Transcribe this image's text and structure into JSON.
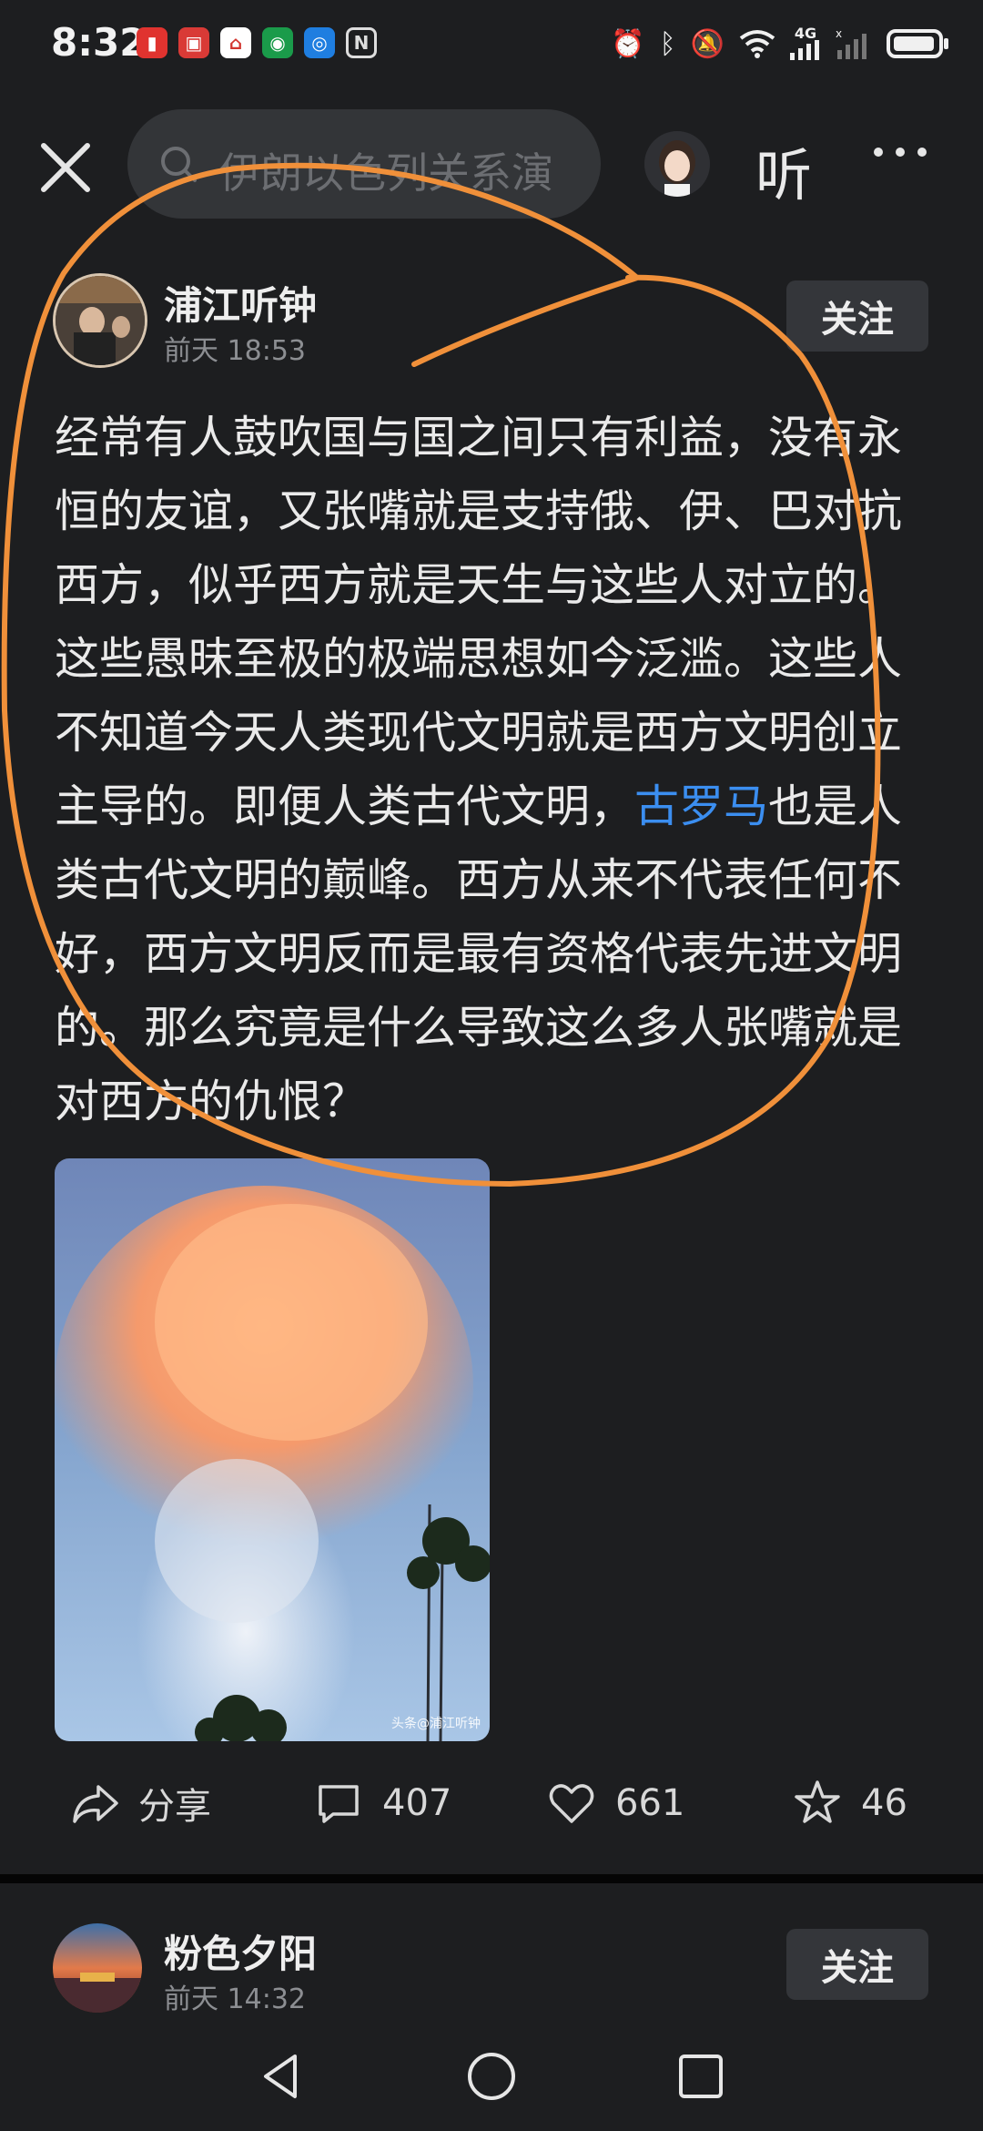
{
  "status_bar": {
    "time": "8:32",
    "network": "4G",
    "battery": "full"
  },
  "top_bar": {
    "search_placeholder": "伊朗以色列关系演",
    "listen_label": "听"
  },
  "post": {
    "author": "浦江听钟",
    "time": "前天  18:53",
    "follow_label": "关注",
    "text_before_link": "经常有人鼓吹国与国之间只有利益，没有永恒的友谊，又张嘴就是支持俄、伊、巴对抗西方，似乎西方就是天生与这些人对立的。这些愚昧至极的极端思想如今泛滥。这些人不知道今天人类现代文明就是西方文明创立主导的。即便人类古代文明，",
    "link_text": "古罗马",
    "text_after_link": "也是人类古代文明的巅峰。西方从来不代表任何不好，西方文明反而是最有资格代表先进文明的。那么究竟是什么导致这么多人张嘴就是对西方的仇恨？",
    "image_watermark": "头条@浦江听钟",
    "actions": {
      "share_label": "分享",
      "comments": "407",
      "likes": "661",
      "favorites": "46"
    }
  },
  "next_post": {
    "author": "粉色夕阳",
    "time": "前天  14:32",
    "follow_label": "关注"
  },
  "colors": {
    "background": "#1d1e20",
    "link": "#3b8ef0",
    "annotation": "#f0903a"
  }
}
